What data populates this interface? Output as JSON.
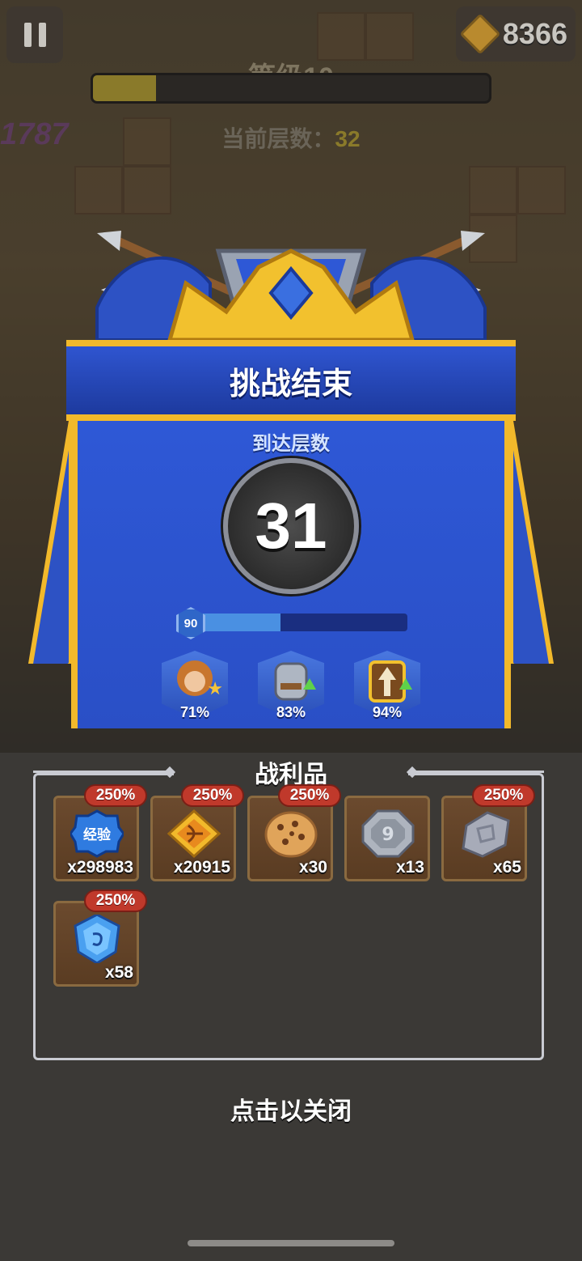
{
  "hud": {
    "currency": "8366",
    "level_title": "等级10",
    "level_progress": 0.16,
    "floor_label": "当前层数：",
    "floor_value": "32",
    "left_number": "1787"
  },
  "result": {
    "title": "挑战结束",
    "reached_label": "到达层数",
    "reached_floor": "31",
    "xp_level": "90",
    "xp_progress": 0.4,
    "stats": [
      {
        "icon": "hero-portrait-icon",
        "percent": "71%"
      },
      {
        "icon": "armor-upgrade-icon",
        "percent": "83%"
      },
      {
        "icon": "arrow-upgrade-icon",
        "percent": "94%"
      }
    ]
  },
  "loot": {
    "title": "战利品",
    "items": [
      {
        "icon": "exp-badge-icon",
        "icon_text": "经验",
        "qty": "x298983",
        "bonus": "250%"
      },
      {
        "icon": "bow-scroll-icon",
        "qty": "x20915",
        "bonus": "250%"
      },
      {
        "icon": "cookie-icon",
        "qty": "x30",
        "bonus": "250%"
      },
      {
        "icon": "silver-coin-icon",
        "qty": "x13",
        "bonus": ""
      },
      {
        "icon": "stone-icon",
        "qty": "x65",
        "bonus": "250%"
      },
      {
        "icon": "blue-crystal-icon",
        "qty": "x58",
        "bonus": "250%"
      }
    ]
  },
  "close_hint": "点击以关闭",
  "colors": {
    "banner_blue": "#2e58d6",
    "gold_trim": "#f2b92b",
    "bonus_red": "#c0392b"
  }
}
